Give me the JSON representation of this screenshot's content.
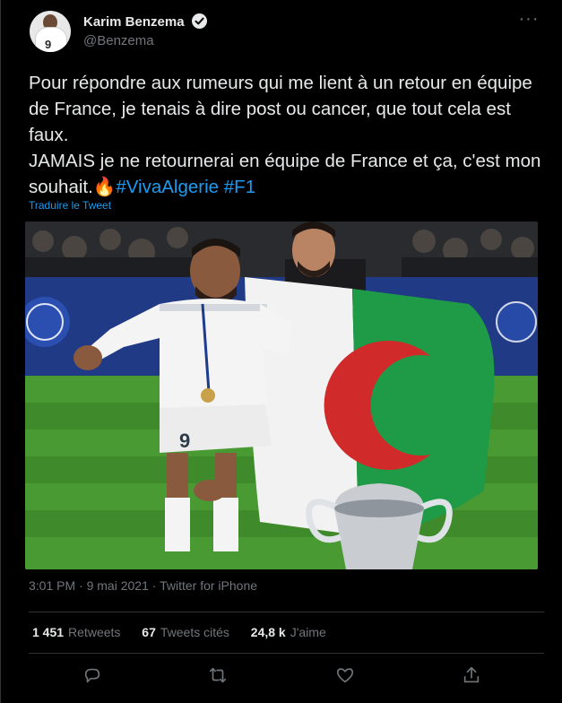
{
  "user": {
    "name": "Karim Benzema",
    "handle": "@Benzema",
    "avatar_jersey_number": "9"
  },
  "tweet": {
    "line1": "Pour répondre aux rumeurs qui me lient à un retour en équipe de France, je tenais à dire post ou cancer, que tout cela est faux.",
    "line2_prefix": "JAMAIS je ne retournerai en équipe de France et ça, c'est mon souhait.",
    "emoji": "🔥",
    "hashtag1": "#VivaAlgerie",
    "hashtag2": "#F1",
    "translate_label": "Traduire le Tweet"
  },
  "photo": {
    "jersey_number": "9"
  },
  "meta": {
    "time": "3:01 PM",
    "date": "9 mai 2021",
    "source": "Twitter for iPhone",
    "separator": " · "
  },
  "stats": {
    "retweets_count": "1 451",
    "retweets_label": "Retweets",
    "quotes_count": "67",
    "quotes_label": "Tweets cités",
    "likes_count": "24,8 k",
    "likes_label": "J'aime"
  },
  "colors": {
    "background": "#000000",
    "text": "#e7e9ea",
    "secondary": "#71767b",
    "link": "#1d9bf0",
    "divider": "#2f3336",
    "flag_green": "#1f9a46",
    "flag_white": "#f2f2f2",
    "flag_red": "#d12a2a"
  },
  "icons": {
    "verified": "verified-badge-icon",
    "more": "more-options-icon",
    "reply": "reply-icon",
    "retweet": "retweet-icon",
    "like": "like-icon",
    "share": "share-icon"
  }
}
